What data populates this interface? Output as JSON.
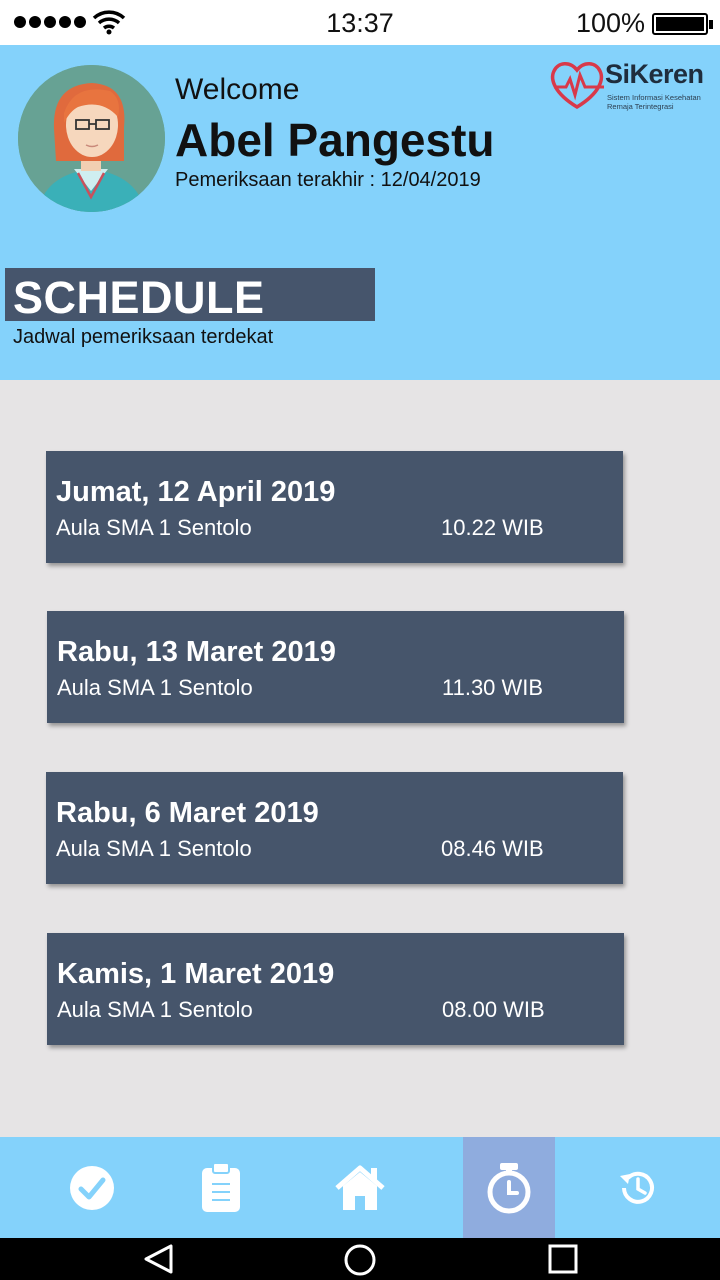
{
  "status_bar": {
    "time": "13:37",
    "battery_percent": "100%",
    "icons": [
      "signal-dots-icon",
      "wifi-icon",
      "battery-icon"
    ]
  },
  "header": {
    "welcome": "Welcome",
    "user_name": "Abel Pangestu",
    "last_check": "Pemeriksaan terakhir : 12/04/2019",
    "logo": {
      "title": "SiKeren",
      "subtitle": "Sistem Informasi Kesehatan Remaja Terintegrasi"
    }
  },
  "schedule": {
    "title": "SCHEDULE",
    "subtitle": "Jadwal pemeriksaan terdekat",
    "items": [
      {
        "date": "Jumat, 12 April 2019",
        "place": "Aula SMA 1 Sentolo",
        "time": "10.22 WIB"
      },
      {
        "date": "Rabu, 13 Maret 2019",
        "place": "Aula SMA 1 Sentolo",
        "time": "11.30 WIB"
      },
      {
        "date": "Rabu, 6 Maret 2019",
        "place": "Aula SMA 1 Sentolo",
        "time": "08.46 WIB"
      },
      {
        "date": "Kamis, 1 Maret 2019",
        "place": "Aula SMA 1 Sentolo",
        "time": "08.00 WIB"
      }
    ]
  },
  "bottom_nav": {
    "items": [
      {
        "icon": "check-circle-icon"
      },
      {
        "icon": "clipboard-icon"
      },
      {
        "icon": "home-icon"
      },
      {
        "icon": "stopwatch-icon",
        "active": true
      },
      {
        "icon": "history-icon"
      }
    ]
  },
  "android_nav": [
    "back-icon",
    "home-circle-icon",
    "recents-icon"
  ],
  "colors": {
    "header_bg": "#84d2fb",
    "card_bg": "#46556b",
    "page_bg": "#e6e4e5",
    "nav_active": "#8facde"
  }
}
